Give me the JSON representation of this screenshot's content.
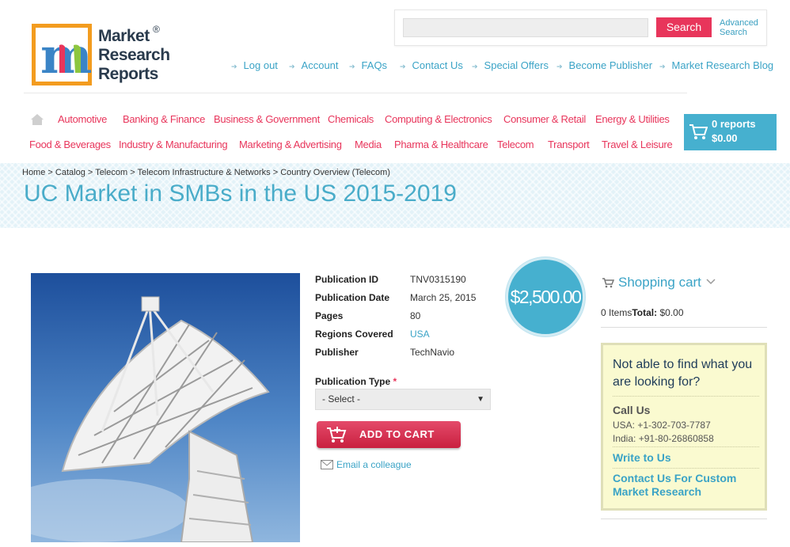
{
  "logo": {
    "line1": "Market",
    "line2": "Research",
    "line3": "Reports",
    "reg": "®",
    "monogram": "m"
  },
  "search": {
    "placeholder": "",
    "button_label": "Search",
    "advanced_line1": "Advanced",
    "advanced_line2": "Search"
  },
  "top_links": [
    "Log out",
    "Account",
    "FAQs",
    "Contact Us",
    "Special Offers",
    "Become Publisher",
    "Market Research Blog"
  ],
  "categories_row1": [
    "Automotive",
    "Banking & Finance",
    "Business & Government",
    "Chemicals",
    "Computing & Electronics",
    "Consumer & Retail",
    "Energy & Utilities"
  ],
  "categories_row2": [
    "Food & Beverages",
    "Industry & Manufacturing",
    "Marketing & Advertising",
    "Media",
    "Pharma & Healthcare",
    "Telecom",
    "Transport",
    "Travel & Leisure"
  ],
  "cart": {
    "reports": "0 reports",
    "total": "$0.00"
  },
  "breadcrumb": [
    "Home",
    "Catalog",
    "Telecom",
    "Telecom Infrastructure & Networks",
    "Country Overview (Telecom)"
  ],
  "breadcrumb_sep": ">",
  "page_title": "UC Market in SMBs in the US 2015-2019",
  "product": {
    "info": [
      {
        "label": "Publication ID",
        "value": "TNV0315190"
      },
      {
        "label": "Publication Date",
        "value": "March 25, 2015"
      },
      {
        "label": "Pages",
        "value": "80"
      },
      {
        "label": "Regions Covered",
        "value": "USA"
      },
      {
        "label": "Publisher",
        "value": "TechNavio"
      }
    ],
    "pub_type_label": "Publication Type",
    "pub_type_required": "*",
    "pub_type_selected": "- Select -",
    "add_to_cart": "ADD TO CART",
    "email_colleague": "Email a colleague",
    "price": "$2,500.00"
  },
  "sidebar": {
    "shopping_cart_title": "Shopping cart",
    "items_label": "0 Items",
    "total_label": "Total:",
    "total_value": "$0.00",
    "help_title": "Not able to find what you are looking for?",
    "call_us": "Call Us",
    "phone_usa": "USA: +1-302-703-7787",
    "phone_india": "India: +91-80-26860858",
    "write_to_us": "Write to Us",
    "contact_custom": "Contact Us For Custom Market Research"
  },
  "colors": {
    "accent_pink": "#e8355b",
    "accent_blue": "#46b0cf",
    "link_blue": "#3aa3c6"
  }
}
